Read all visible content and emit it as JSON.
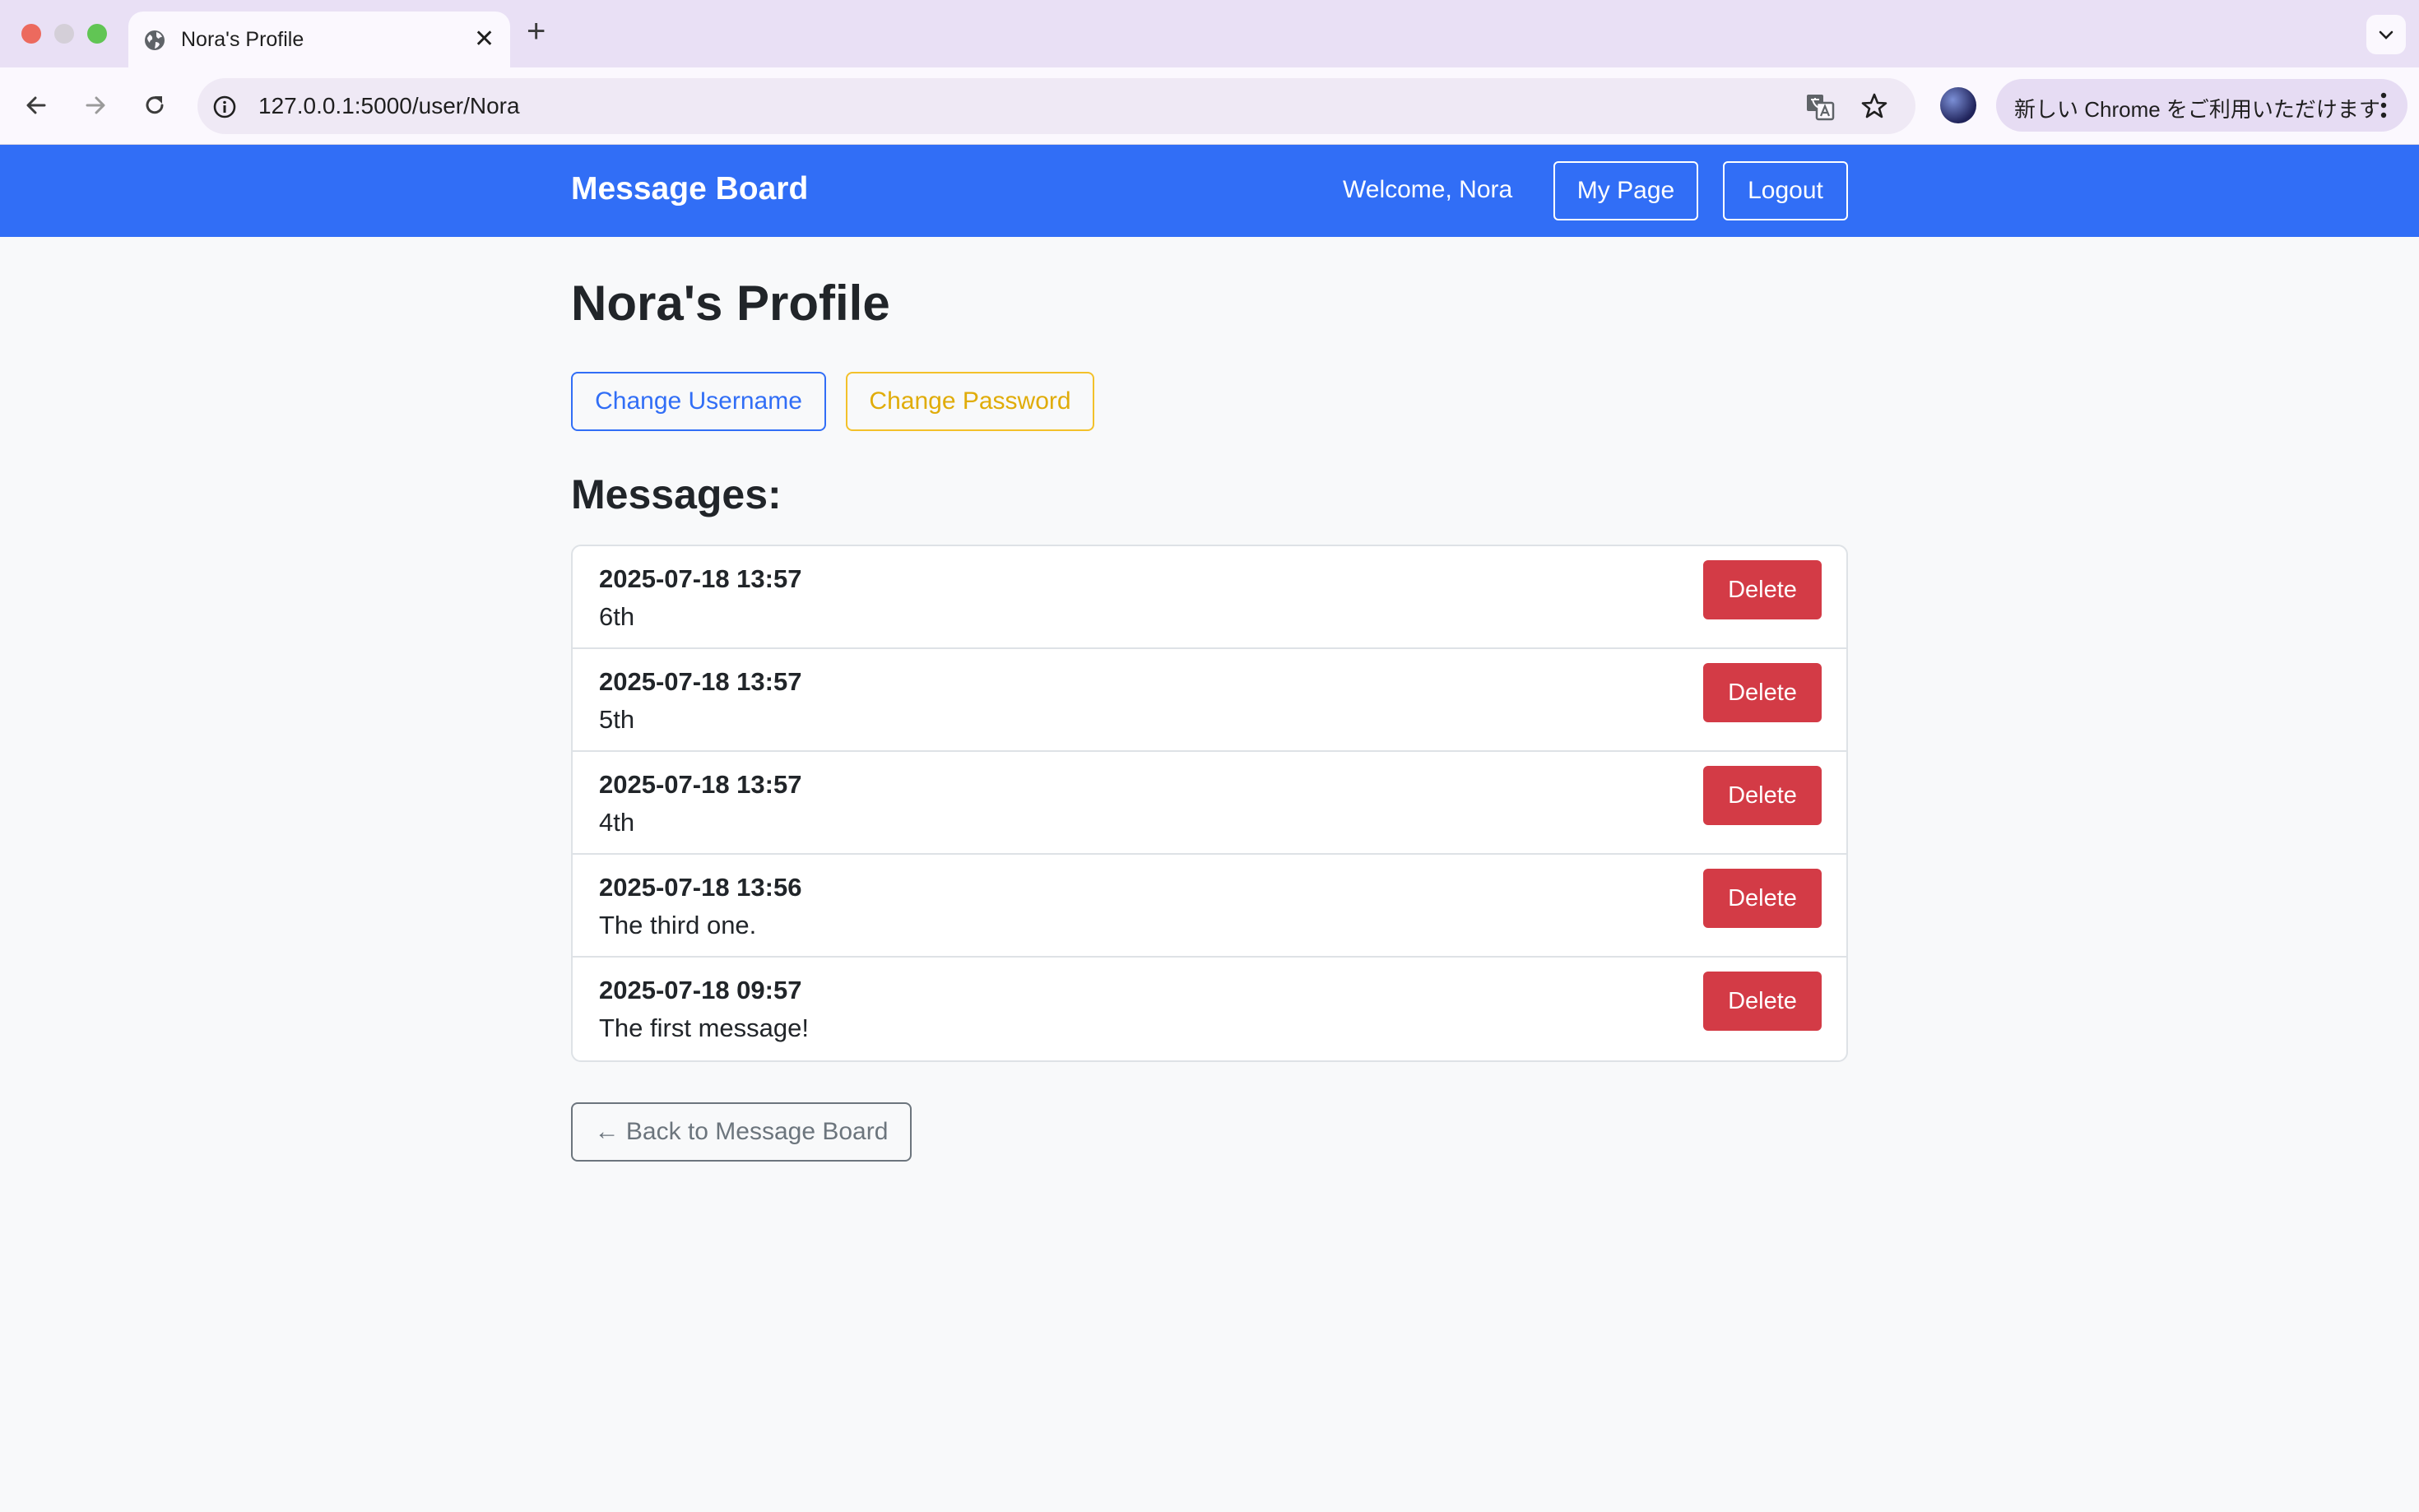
{
  "browser": {
    "tab_title": "Nora's Profile",
    "tab_close_glyph": "✕",
    "new_tab_glyph": "+",
    "url": "127.0.0.1:5000/user/Nora",
    "update_text": "新しい Chrome をご利用いただけます"
  },
  "navbar": {
    "brand": "Message Board",
    "welcome": "Welcome, Nora",
    "my_page_label": "My Page",
    "logout_label": "Logout"
  },
  "profile": {
    "title": "Nora's Profile",
    "change_username_label": "Change Username",
    "change_password_label": "Change Password",
    "messages_heading": "Messages:",
    "back_label": "← Back to Message Board"
  },
  "messages": [
    {
      "time": "2025-07-18 13:57",
      "text": "6th",
      "delete_label": "Delete"
    },
    {
      "time": "2025-07-18 13:57",
      "text": "5th",
      "delete_label": "Delete"
    },
    {
      "time": "2025-07-18 13:57",
      "text": "4th",
      "delete_label": "Delete"
    },
    {
      "time": "2025-07-18 13:56",
      "text": "The third one.",
      "delete_label": "Delete"
    },
    {
      "time": "2025-07-18 09:57",
      "text": "The first message!",
      "delete_label": "Delete"
    }
  ],
  "colors": {
    "primary": "#316ef6",
    "warning": "#f3c12a",
    "danger": "#d33b46",
    "secondary": "#6c757d",
    "page_bg": "#f8f9fa"
  }
}
